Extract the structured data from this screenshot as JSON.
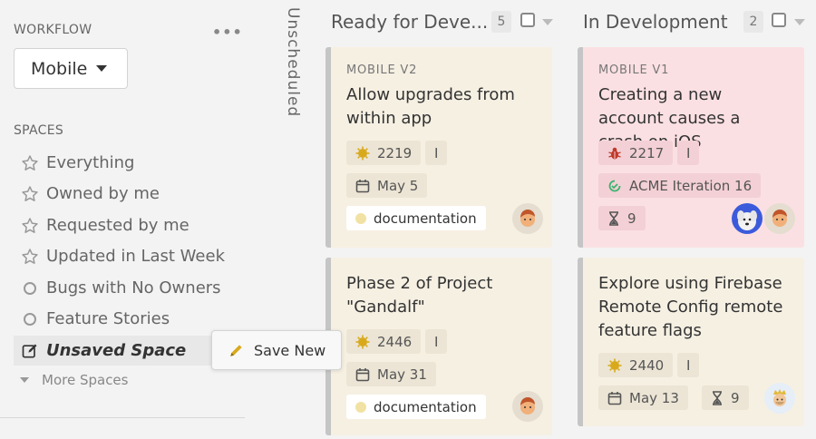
{
  "sidebar": {
    "workflow_label": "WORKFLOW",
    "more_label": "•••",
    "workflow_value": "Mobile",
    "spaces_label": "SPACES",
    "spaces": [
      {
        "label": "Everything",
        "icon": "star-icon"
      },
      {
        "label": "Owned by me",
        "icon": "star-icon"
      },
      {
        "label": "Requested by me",
        "icon": "star-icon"
      },
      {
        "label": "Updated in Last Week",
        "icon": "star-icon"
      },
      {
        "label": "Bugs with No Owners",
        "icon": "circle-icon"
      },
      {
        "label": "Feature Stories",
        "icon": "circle-icon"
      },
      {
        "label": "Unsaved Space",
        "icon": "edit-icon"
      }
    ],
    "more_spaces": "More Spaces"
  },
  "popover": {
    "save_new": "Save New"
  },
  "board": {
    "unscheduled_label": "Unscheduled",
    "columns": [
      {
        "title": "Ready for Deve...",
        "count": "5",
        "cards": [
          {
            "project": "MOBILE V2",
            "title": "Allow upgrades from within app",
            "story_id": "2219",
            "estimate": "I",
            "date": "May 5",
            "label": "documentation"
          },
          {
            "title": "Phase 2 of Project \"Gandalf\"",
            "story_id": "2446",
            "estimate": "I",
            "date": "May 31",
            "label": "documentation"
          }
        ]
      },
      {
        "title": "In Development",
        "count": "2",
        "cards": [
          {
            "project": "MOBILE V1",
            "title": "Creating a new account causes a crash on iOS",
            "story_id": "2217",
            "estimate": "I",
            "iteration": "ACME Iteration 16",
            "hourglass": "9"
          },
          {
            "title": "Explore using Firebase Remote Config remote feature flags",
            "story_id": "2440",
            "estimate": "I",
            "date": "May 13",
            "hourglass": "9"
          }
        ]
      }
    ]
  },
  "colors": {
    "card_tan": "#f6f0e3",
    "card_pink": "#fbe0e3",
    "feature_gold": "#d9a91c",
    "bug_red": "#c0392b",
    "iteration_green": "#3cb371"
  }
}
